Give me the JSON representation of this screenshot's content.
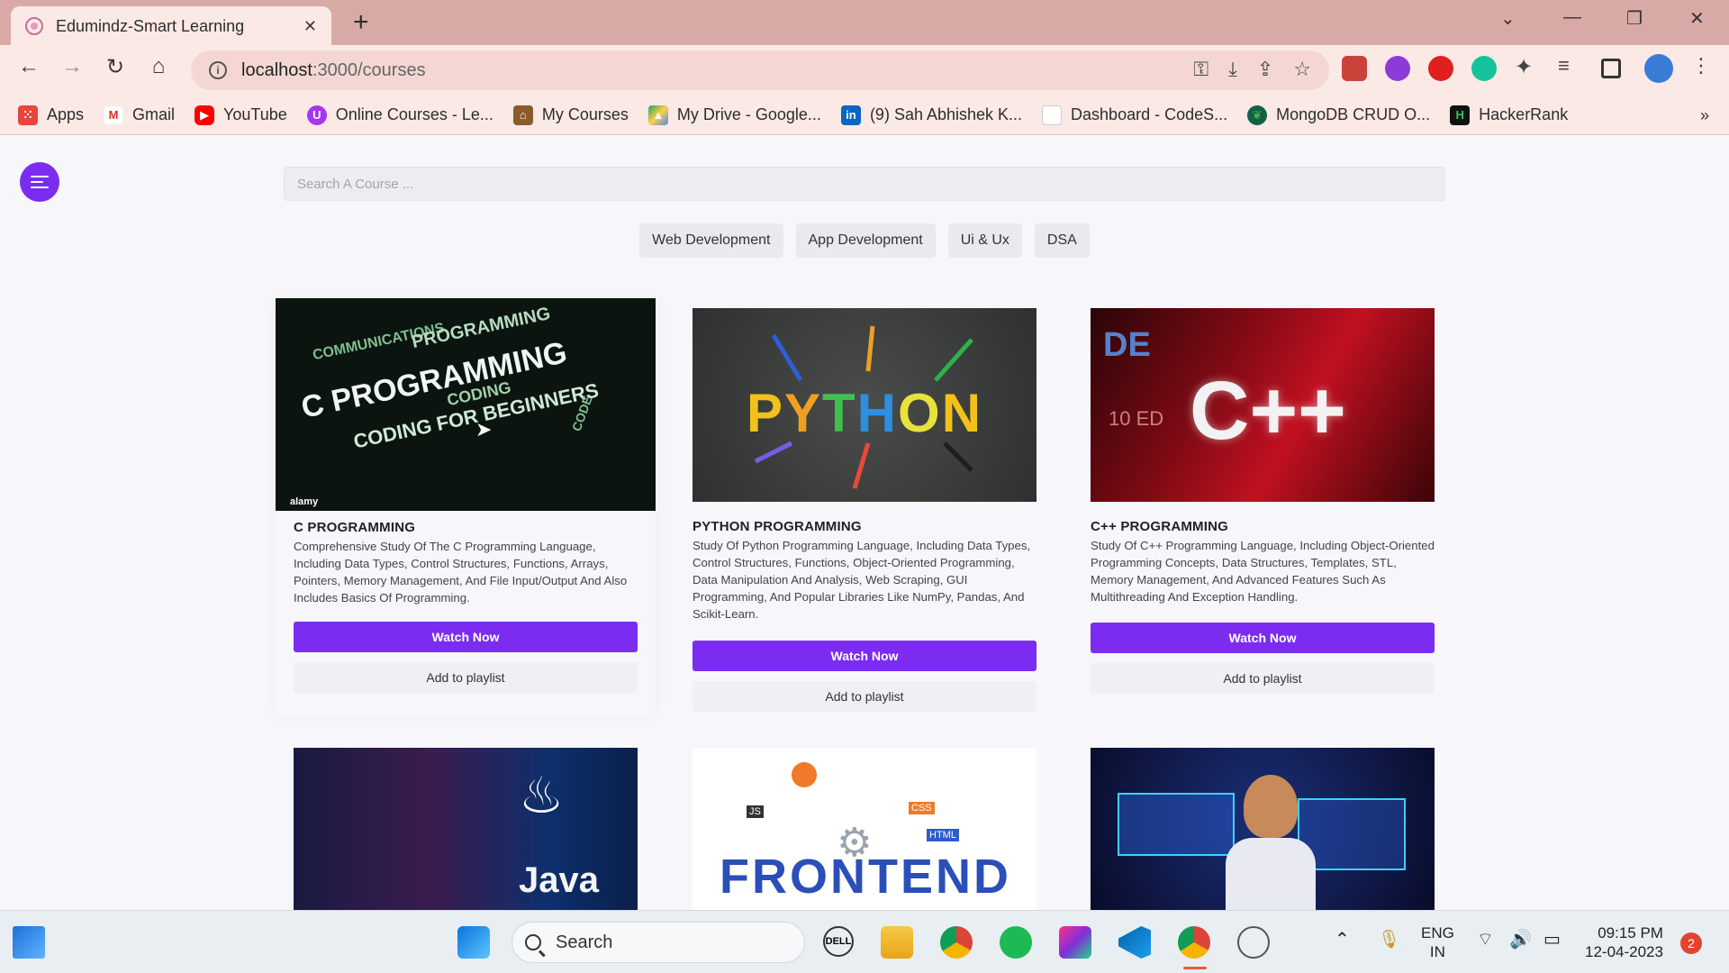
{
  "browser": {
    "tab_title": "Edumindz-Smart Learning",
    "tab_close": "✕",
    "new_tab": "+",
    "url_host": "localhost",
    "url_path": ":3000/courses",
    "bookmarks": [
      {
        "label": "Apps",
        "icon": "apps-grid-icon",
        "color": "#e8453c"
      },
      {
        "label": "Gmail",
        "icon": "gmail-icon",
        "color": "#d93025"
      },
      {
        "label": "YouTube",
        "icon": "youtube-icon",
        "color": "#ff0000"
      },
      {
        "label": "Online Courses - Le...",
        "icon": "udemy-icon",
        "color": "#a435f0"
      },
      {
        "label": "My Courses",
        "icon": "courses-icon",
        "color": "#8a5a2b"
      },
      {
        "label": "My Drive - Google...",
        "icon": "google-drive-icon",
        "color": "#1fa463"
      },
      {
        "label": "(9) Sah Abhishek K...",
        "icon": "linkedin-icon",
        "color": "#0a66c2"
      },
      {
        "label": "Dashboard - CodeS...",
        "icon": "page-icon",
        "color": "#cccccc"
      },
      {
        "label": "MongoDB CRUD O...",
        "icon": "mongodb-icon",
        "color": "#116149"
      },
      {
        "label": "HackerRank",
        "icon": "hackerrank-icon",
        "color": "#111111"
      }
    ],
    "bookmarks_more": "»"
  },
  "page": {
    "search_placeholder": "Search A Course ...",
    "categories": [
      "Web Development",
      "App Development",
      "Ui & Ux",
      "DSA"
    ],
    "courses": [
      {
        "title": "C PROGRAMMING",
        "description": "Comprehensive Study Of The C Programming Language, Including Data Types, Control Structures, Functions, Arrays, Pointers, Memory Management, And File Input/Output And Also Includes Basics Of Programming.",
        "watch": "Watch Now",
        "playlist": "Add to playlist",
        "thumb_text": [
          "C PROGRAMMING",
          "CODING FOR BEGINNERS",
          "COMMUNICATIONS",
          "PROGRAMMING",
          "CODING",
          "CODE"
        ],
        "thumb_watermark": "alamy"
      },
      {
        "title": "PYTHON PROGRAMMING",
        "description": "Study Of Python Programming Language, Including Data Types, Control Structures, Functions, Object-Oriented Programming, Data Manipulation And Analysis, Web Scraping, GUI Programming, And Popular Libraries Like NumPy, Pandas, And Scikit-Learn.",
        "watch": "Watch Now",
        "playlist": "Add to playlist",
        "thumb_text": "PYTHON"
      },
      {
        "title": "C++ PROGRAMMING",
        "description": "Study Of C++ Programming Language, Including Object-Oriented Programming Concepts, Data Structures, Templates, STL, Memory Management, And Advanced Features Such As Multithreading And Exception Handling.",
        "watch": "Watch Now",
        "playlist": "Add to playlist",
        "thumb_text": "C++"
      }
    ],
    "partial_cards": [
      {
        "thumb_text": "Java"
      },
      {
        "thumb_text": "FRONTEND",
        "tags": [
          "JS",
          "CSS",
          "HTML"
        ]
      },
      {
        "thumb_text": ""
      }
    ]
  },
  "taskbar": {
    "search_label": "Search",
    "lang": "ENG",
    "region": "IN",
    "time": "09:15 PM",
    "date": "12-04-2023",
    "notifications": "2"
  },
  "colors": {
    "accent": "#7b2cf0",
    "tab_strip": "#d9aaa5",
    "toolbar": "#fbe9e6"
  }
}
